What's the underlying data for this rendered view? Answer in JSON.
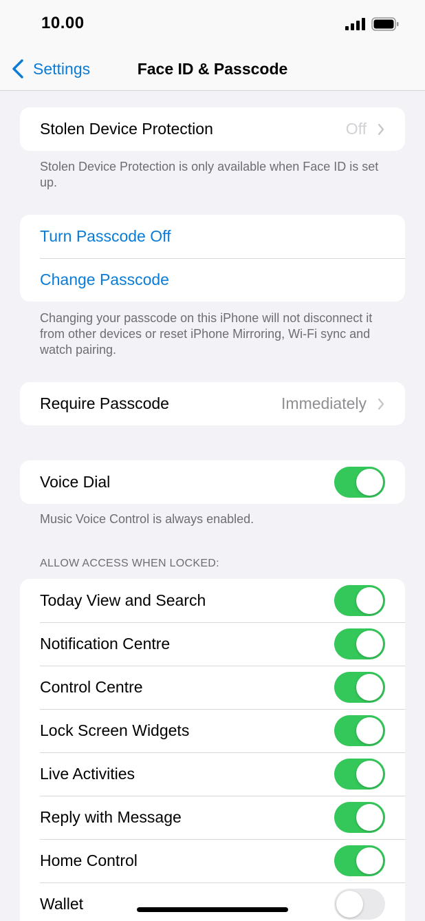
{
  "status_bar": {
    "time": "10.00"
  },
  "nav": {
    "back_label": "Settings",
    "title": "Face ID & Passcode"
  },
  "stolen_device": {
    "label": "Stolen Device Protection",
    "value": "Off",
    "note": "Stolen Device Protection is only available when Face ID is set up."
  },
  "passcode": {
    "turn_off_label": "Turn Passcode Off",
    "change_label": "Change Passcode",
    "note": "Changing your passcode on this iPhone will not disconnect it from other devices or reset iPhone Mirroring, Wi-Fi sync and watch pairing."
  },
  "require_passcode": {
    "label": "Require Passcode",
    "value": "Immediately"
  },
  "voice_dial": {
    "label": "Voice Dial",
    "enabled": true,
    "note": "Music Voice Control is always enabled."
  },
  "locked_access": {
    "header": "ALLOW ACCESS WHEN LOCKED:",
    "items": [
      {
        "label": "Today View and Search",
        "enabled": true
      },
      {
        "label": "Notification Centre",
        "enabled": true
      },
      {
        "label": "Control Centre",
        "enabled": true
      },
      {
        "label": "Lock Screen Widgets",
        "enabled": true
      },
      {
        "label": "Live Activities",
        "enabled": true
      },
      {
        "label": "Reply with Message",
        "enabled": true
      },
      {
        "label": "Home Control",
        "enabled": true
      },
      {
        "label": "Wallet",
        "enabled": false
      }
    ]
  },
  "colors": {
    "accent": "#0a7bd6",
    "toggle_on": "#34c759",
    "toggle_off": "#e9e9eb",
    "background": "#f2f2f7"
  },
  "icons": {
    "back": "chevron-left-icon",
    "disclosure": "chevron-right-icon",
    "signal": "cellular-signal-icon",
    "battery": "battery-icon"
  }
}
